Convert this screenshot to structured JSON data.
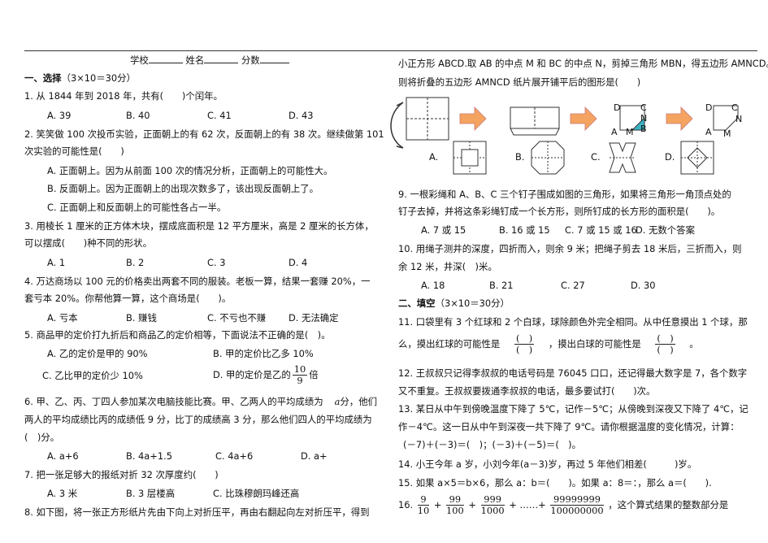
{
  "header": {
    "school": "学校",
    "name": "姓名",
    "score": "分数"
  },
  "sec1": {
    "title": "一、选择",
    "score_note": "（3×10＝30分）"
  },
  "q1": {
    "stem": "1. 从 1844 年到 2018 年，共有(　　)个闰年。",
    "opts": [
      "A. 39",
      "B. 40",
      "C. 41",
      "D. 43"
    ]
  },
  "q2": {
    "stem1": "2. 笑笑做 100 次投币实验，正面朝上的有 62 次，反面朝上的有 38 次。继续做第 101",
    "stem2": "次实验的可能性是(　　)",
    "opts": [
      "A. 正面朝上。因为从前面 100 次的情况分析，正面朝上的可能性大。",
      "B. 反面朝上。因为正面朝上的出现次数多了，该出现反面朝上了。",
      "C. 正面朝上和反面朝上的可能性各占一半。"
    ]
  },
  "q3": {
    "stem1": "3. 用棱长 1 厘米的正方体木块，摆成底面积是 12 平方厘米，高是 2 厘米的长方体，",
    "stem2": "可以摆成(　　)种不同的形状。",
    "opts": [
      "A. 1",
      "B. 2",
      "C. 3",
      "D. 4"
    ]
  },
  "q4": {
    "stem1": "4. 万达商场以 100 元的价格卖出两套不同的服装。老板一算，结果一套赚 20%，一",
    "stem2": "套亏本 20%。你帮他算一算，这个商场是(　　)。",
    "opts": [
      "A. 亏本",
      "B. 赚钱",
      "C. 不亏也不赚",
      "D. 无法确定"
    ]
  },
  "q5": {
    "stem": "5. 商品甲的定价打九折后和商品乙的定价相等，下面说法不正确的是(　)。",
    "opts": [
      "A. 乙的定价是甲的 90%",
      "B. 甲的定价比乙多 10%",
      "C. 乙比甲的定价少 10%",
      "D. 甲的定价是乙的",
      "倍"
    ],
    "frac_n": "10",
    "frac_d": "9"
  },
  "q6": {
    "stem1": "6. 甲、乙、丙、丁四人参加某次电脑技能比赛。甲、乙两人的平均成绩为",
    "var": "a",
    "stem1b": "分，他们",
    "stem2": "两人的平均成绩比丙的成绩低 9 分，比丁的成绩高 3 分，那么他们四人的平均成绩为",
    "stem3": "(　)分。",
    "opts": [
      "A. a+6",
      "B. 4a+1.5",
      "C. 4a+6",
      "D. a+"
    ]
  },
  "q7": {
    "stem": "7. 把一张足够大的报纸对折 32 次厚度约(　　)",
    "opts": [
      "A. 3 米",
      "B. 3 层楼高",
      "C. 比珠穆朗玛峰还高"
    ]
  },
  "q8": {
    "stem1": "8. 如下图，将一张正方形纸片先由下向上对折压平，再由右翻起向左对折压平，得到",
    "stem2": "小正方形 ABCD.取 AB 的中点 M 和 BC 的中点 N，剪掉三角形 MBN，得五边形 AMNCD。",
    "stem3": "则将折叠的五边形 AMNCD 纸片展开铺平后的图形是(　　)",
    "fig_labels": [
      "A",
      "B",
      "C",
      "D",
      "M",
      "N"
    ],
    "opts": [
      "A.",
      "B.",
      "C.",
      "D."
    ]
  },
  "q9": {
    "stem1": "9. 一根彩绳和 A、B、C 三个钉子围成如图的三角形，如果将三角形一角顶点处的",
    "stem2": "钉子去掉，并将这条彩绳钉成一个长方形，则所钉成的长方形的面积是(　　)。",
    "opts": [
      "A. 7 或 15",
      "B. 16 或 15",
      "C. 7 或 15 或 16",
      "D. 无数个答案"
    ]
  },
  "q10": {
    "stem1": "10. 用绳子测井的深度，四折而入，则余 9 米；把绳子剪去 18 米后，三折而入，则",
    "stem2": "余 12 米，井深(　)米。",
    "opts": [
      "A. 18",
      "B. 21",
      "C. 27",
      "D. 30"
    ]
  },
  "sec2": {
    "title": "二、填空",
    "score_note": "（3×10＝30分）"
  },
  "q11": {
    "stem1": "11. 口袋里有 3 个红球和 2 个白球，球除颜色外完全相同。从中任意摸出 1 个球，那",
    "stem2a": "么，摸出红球的可能性是",
    "stem2b": "，摸出白球的可能性是",
    "stem2c": "。"
  },
  "q12": {
    "stem1": "12. 王叔叔只记得李叔叔的电话号码是 76045 口口，还记得最大数字是 7，各个数字",
    "stem2": "又不重复。王叔叔要拨通李叔叔的电话，最多要试打(　　)次。"
  },
  "q13": {
    "stem1": "13. 某日从中午到傍晚温度下降了 5℃，记作－5℃；从傍晚到深夜又下降了 4℃，记",
    "stem2": "作－4℃。这一日从中午到深夜一共下降了 9℃。请你根据温度的变化情况，计算：",
    "stem3": "(－7)＋(－3)＝(　)；(－3)＋(－5)＝(　)。"
  },
  "q14": {
    "stem": "14. 小王今年 a 岁，小刘今年(a－3)岁，再过 5 年他们相差(　　　)岁。"
  },
  "q15": {
    "stem": "15. 如果 a×5＝b×6，那么 a：b＝(　　)。如果 a：8＝：，那么 a＝(　　)."
  },
  "q16": {
    "prefix": "16.",
    "fracs": [
      [
        "9",
        "10"
      ],
      [
        "99",
        "100"
      ],
      [
        "999",
        "1000"
      ],
      [
        "99999999",
        "100000000"
      ]
    ],
    "ellipsis": "+ ……+",
    "suffix": "，这个算式结果的整数部分是"
  }
}
